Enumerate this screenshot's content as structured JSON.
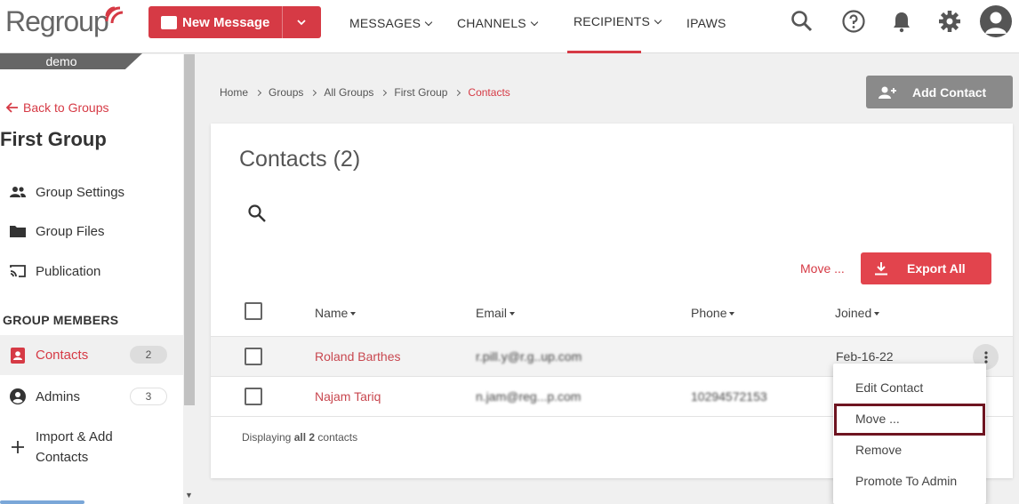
{
  "brand": {
    "name": "Regroup",
    "accent": "#d63a45"
  },
  "header": {
    "new_message_label": "New Message",
    "nav": [
      {
        "label": "MESSAGES"
      },
      {
        "label": "CHANNELS"
      },
      {
        "label": "RECIPIENTS",
        "active": true
      },
      {
        "label": "IPAWS"
      }
    ],
    "icons": [
      "search-icon",
      "help-icon",
      "bell-icon",
      "gear-icon",
      "user-avatar-icon"
    ]
  },
  "sidebar": {
    "account": "demo",
    "back_label": "Back to Groups",
    "group_title": "First Group",
    "items": [
      {
        "label": "Group Settings",
        "icon": "people-icon"
      },
      {
        "label": "Group Files",
        "icon": "folder-icon"
      },
      {
        "label": "Publication",
        "icon": "cast-icon"
      }
    ],
    "section_label": "GROUP MEMBERS",
    "members": [
      {
        "label": "Contacts",
        "count": "2",
        "icon": "contact-card-icon",
        "active": true
      },
      {
        "label": "Admins",
        "count": "3",
        "icon": "account-circle-icon"
      },
      {
        "label": "Import & Add Contacts",
        "line1": "Import & Add",
        "line2": "Contacts",
        "icon": "plus-icon"
      }
    ]
  },
  "breadcrumb": [
    "Home",
    "Groups",
    "All Groups",
    "First Group",
    "Contacts"
  ],
  "add_contact_label": "Add Contact",
  "contacts_panel": {
    "title": "Contacts (2)",
    "move_label": "Move ...",
    "export_label": "Export All",
    "columns": [
      "Name",
      "Email",
      "Phone",
      "Joined"
    ],
    "rows": [
      {
        "name": "Roland Barthes",
        "email": "rpillay@regroup.com",
        "email_obscured": "r.pill.y@r.g..up.com",
        "phone": "",
        "joined": "Feb-16-22"
      },
      {
        "name": "Najam Tariq",
        "email": "najam@regroup.com",
        "email_obscured": "n.jam@reg...p.com",
        "phone": "10294572153",
        "joined": ""
      }
    ],
    "footer_prefix": "Displaying ",
    "footer_bold": "all 2",
    "footer_suffix": " contacts"
  },
  "row_menu": {
    "items": [
      "Edit Contact",
      "Move ...",
      "Remove",
      "Promote To Admin"
    ],
    "highlighted": "Move ..."
  }
}
